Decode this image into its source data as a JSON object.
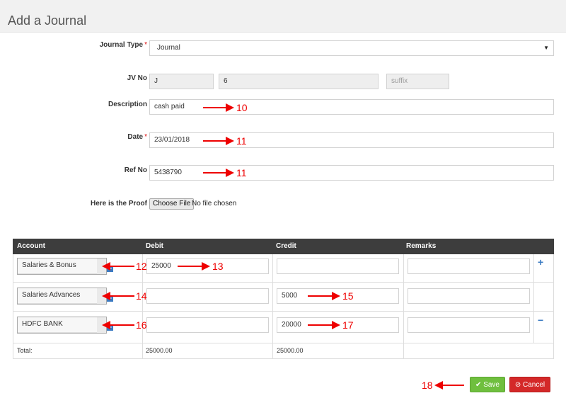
{
  "header": {
    "title": "Add a Journal"
  },
  "form": {
    "journal_type": {
      "label": "Journal Type",
      "required_mark": "*",
      "value": "Journal"
    },
    "jv_no": {
      "label": "JV No",
      "prefix": "J",
      "number": "6",
      "suffix_placeholder": "suffix"
    },
    "description": {
      "label": "Description",
      "value": "cash paid"
    },
    "date": {
      "label": "Date",
      "required_mark": "*",
      "value": "23/01/2018"
    },
    "ref_no": {
      "label": "Ref No",
      "value": "5438790"
    },
    "proof": {
      "label": "Here is the Proof",
      "button": "Choose File",
      "status": "No file chosen"
    }
  },
  "table": {
    "headers": [
      "Account",
      "Debit",
      "Credit",
      "Remarks"
    ],
    "rows": [
      {
        "account": "Salaries & Bonus",
        "debit": "25000",
        "credit": "",
        "remarks": ""
      },
      {
        "account": "Salaries Advances",
        "debit": "",
        "credit": "5000",
        "remarks": ""
      },
      {
        "account": "HDFC BANK",
        "debit": "",
        "credit": "20000",
        "remarks": ""
      }
    ],
    "total_label": "Total:",
    "total_debit": "25000.00",
    "total_credit": "25000.00",
    "add_symbol": "+",
    "remove_symbol": "−"
  },
  "annotations": {
    "a10": "10",
    "a11a": "11",
    "a11b": "11",
    "a12": "12",
    "a13": "13",
    "a14": "14",
    "a15": "15",
    "a16": "16",
    "a17": "17",
    "a18": "18"
  },
  "actions": {
    "save": "Save",
    "cancel": "Cancel",
    "save_icon": "✔",
    "cancel_icon": "⊘"
  },
  "colors": {
    "annotation": "#e00000",
    "save": "#6fbf3e",
    "cancel": "#d42828",
    "table_header": "#3d3d3d"
  }
}
